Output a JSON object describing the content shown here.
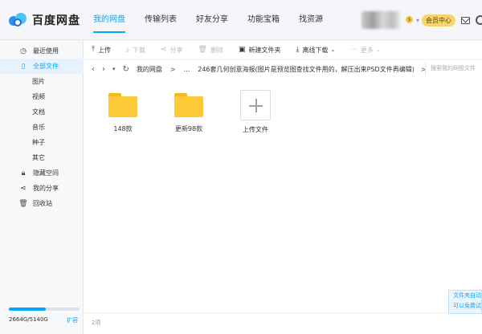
{
  "app": {
    "name": "百度网盘"
  },
  "nav": [
    "我的网盘",
    "传输列表",
    "好友分享",
    "功能宝箱",
    "找资源"
  ],
  "header": {
    "vip_badge": "$",
    "member_label": "会员中心"
  },
  "sidebar": {
    "items": [
      {
        "label": "最近使用",
        "icon": "clock-icon"
      },
      {
        "label": "全部文件",
        "icon": "file-icon"
      },
      {
        "label": "图片"
      },
      {
        "label": "视频"
      },
      {
        "label": "文档"
      },
      {
        "label": "音乐"
      },
      {
        "label": "种子"
      },
      {
        "label": "其它"
      },
      {
        "label": "隐藏空间",
        "icon": "lock-icon"
      },
      {
        "label": "我的分享",
        "icon": "share-icon"
      },
      {
        "label": "回收站",
        "icon": "trash-icon"
      }
    ],
    "storage_text": "2664G/5140G",
    "storage_fraction": 0.518,
    "expand_label": "扩容"
  },
  "toolbar": {
    "upload": "上传",
    "download": "下载",
    "share": "分享",
    "delete": "删除",
    "new_folder": "新建文件夹",
    "offline_download": "离线下载",
    "more": "更多"
  },
  "path": {
    "root": "我的网盘",
    "ellipsis": "...",
    "current": "246套几何创意海报(图片是预览图查找文件用的，解压出来PSD文件再编辑)",
    "search_placeholder": "搜索我的网盘文件"
  },
  "files": [
    {
      "name": "148款",
      "type": "folder"
    },
    {
      "name": "更新98款",
      "type": "folder"
    },
    {
      "name": "上传文件",
      "type": "upload"
    }
  ],
  "footer": {
    "count": "2项"
  },
  "tip": {
    "line1": "文件夹自动",
    "line2": "可以免费试"
  },
  "colors": {
    "accent": "#06a7ff",
    "folder": "#fdc936",
    "member": "#f8d56b"
  }
}
